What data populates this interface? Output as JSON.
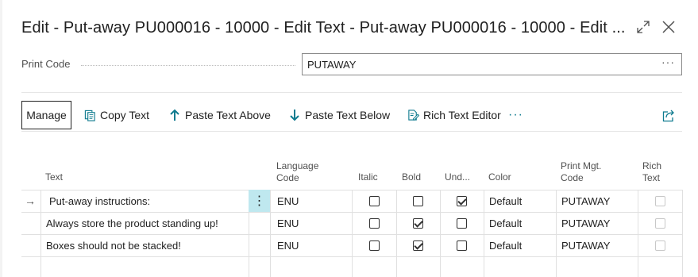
{
  "dialog": {
    "title": "Edit - Put-away PU000016 - 10000 - Edit Text - Put-away PU000016 - 10000 - Edit ...",
    "expand_icon": "expand-icon",
    "close_icon": "close-icon"
  },
  "print_code": {
    "label": "Print Code",
    "value": "PUTAWAY",
    "assist_label": "···"
  },
  "toolbar": {
    "manage": "Manage",
    "copy_text": "Copy Text",
    "paste_above": "Paste Text Above",
    "paste_below": "Paste Text Below",
    "rich_text_editor": "Rich Text Editor",
    "more": "···",
    "icons": [
      "copy-icon",
      "arrow-up-icon",
      "arrow-down-icon",
      "rich-text-icon",
      "share-icon"
    ],
    "accent_color": "#0f7b8f"
  },
  "grid": {
    "headers": {
      "text": "Text",
      "language_code_1": "Language",
      "language_code_2": "Code",
      "italic": "Italic",
      "bold": "Bold",
      "underline": "Und...",
      "color": "Color",
      "print_mgt_code_1": "Print Mgt.",
      "print_mgt_code_2": "Code",
      "rich_text_1": "Rich",
      "rich_text_2": "Text"
    },
    "rows": [
      {
        "text": "Put-away instructions:",
        "language": "ENU",
        "italic": false,
        "bold": false,
        "underline": true,
        "color": "Default",
        "print_mgt_code": "PUTAWAY",
        "rich_text": false,
        "selected": true
      },
      {
        "text": "Always store the product standing up!",
        "language": "ENU",
        "italic": false,
        "bold": true,
        "underline": false,
        "color": "Default",
        "print_mgt_code": "PUTAWAY",
        "rich_text": false,
        "selected": false
      },
      {
        "text": "Boxes should not be stacked!",
        "language": "ENU",
        "italic": false,
        "bold": true,
        "underline": false,
        "color": "Default",
        "print_mgt_code": "PUTAWAY",
        "rich_text": false,
        "selected": false
      }
    ],
    "row_menu_label": "⋮",
    "row_arrow_label": "→",
    "selected_highlight": "#bfe8ef"
  }
}
